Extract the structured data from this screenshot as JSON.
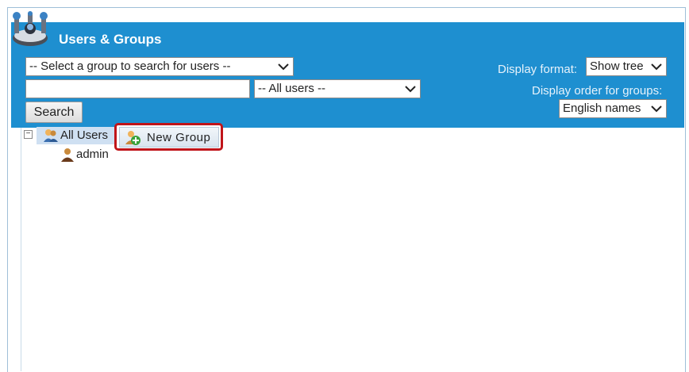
{
  "header": {
    "title": "Users & Groups",
    "icon": "users-network-icon",
    "background_color": "#1e8fd0"
  },
  "search": {
    "group_select_value": "-- Select a group to search for users --",
    "text_value": "",
    "user_filter_value": "-- All users --",
    "button_label": "Search"
  },
  "display": {
    "format_label": "Display format:",
    "format_value": "Show tree",
    "order_label": "Display order for groups:",
    "order_value": "English names"
  },
  "tree": {
    "root_label": "All Users",
    "root_icon": "group-icon",
    "items": [
      {
        "label": "admin",
        "icon": "user-icon"
      }
    ]
  },
  "new_group": {
    "label": "New Group",
    "icon": "add-group-icon",
    "highlight_color": "#c0151a"
  }
}
